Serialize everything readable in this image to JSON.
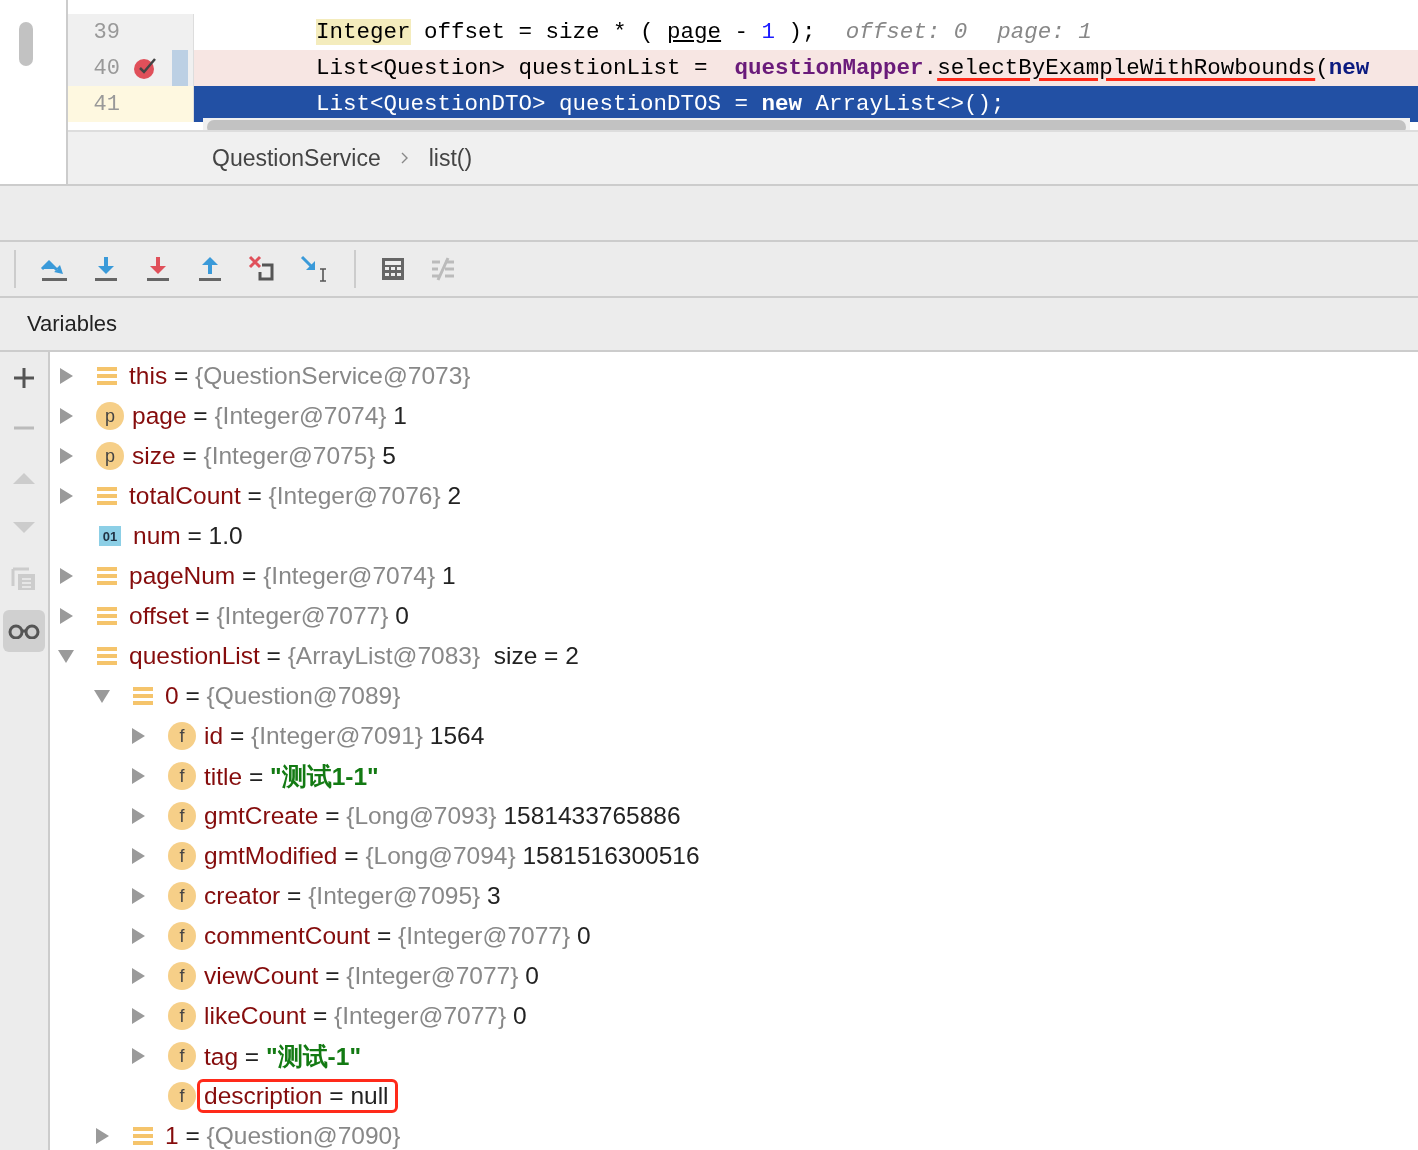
{
  "editor": {
    "lines": [
      {
        "number": "39",
        "current": false,
        "breakpoint": false,
        "tokens": [
          {
            "kind": "highlight",
            "text": "Integer"
          },
          {
            "kind": "plain",
            "text": " offset = size * ( "
          },
          {
            "kind": "underline",
            "text": "page"
          },
          {
            "kind": "plain",
            "text": " - "
          },
          {
            "kind": "number",
            "text": "1"
          },
          {
            "kind": "plain",
            "text": " );"
          },
          {
            "kind": "hint",
            "text": "offset: 0"
          },
          {
            "kind": "hint",
            "text": "page: 1"
          }
        ]
      },
      {
        "number": "40",
        "current": false,
        "breakpoint": true,
        "tokens": [
          {
            "kind": "plain",
            "text": "List<Question> questionList =  "
          },
          {
            "kind": "field",
            "text": "questionMapper"
          },
          {
            "kind": "plain",
            "text": "."
          },
          {
            "kind": "marked",
            "text": "selectByExampleWithRowbounds"
          },
          {
            "kind": "plain",
            "text": "("
          },
          {
            "kind": "keyword",
            "text": "new"
          }
        ]
      },
      {
        "number": "41",
        "current": true,
        "breakpoint": false,
        "tokens": [
          {
            "kind": "plain",
            "text": "List<QuestionDTO> questionDTOS = "
          },
          {
            "kind": "keyword",
            "text": "new"
          },
          {
            "kind": "plain",
            "text": " ArrayList<>();"
          }
        ]
      }
    ],
    "breadcrumbs": [
      "QuestionService",
      "list()"
    ]
  },
  "panel": {
    "title": "Variables"
  },
  "variables": [
    {
      "kind": "object",
      "name": "this",
      "op": "=",
      "ref": "{QuestionService@7073}",
      "expanded": false,
      "marked": false
    },
    {
      "kind": "param",
      "badge": "p",
      "name": "page",
      "op": "=",
      "ref": "{Integer@7074}",
      "value": "1",
      "expanded": false,
      "marked": false
    },
    {
      "kind": "param",
      "badge": "p",
      "name": "size",
      "op": "=",
      "ref": "{Integer@7075}",
      "value": "5",
      "expanded": false,
      "marked": false
    },
    {
      "kind": "object",
      "name": "totalCount",
      "op": "=",
      "ref": "{Integer@7076}",
      "value": "2",
      "expanded": false,
      "marked": false
    },
    {
      "kind": "primitive",
      "badge": "01",
      "name": "num",
      "op": "=",
      "value": "1.0",
      "marked": false
    },
    {
      "kind": "object",
      "name": "pageNum",
      "op": "=",
      "ref": "{Integer@7074}",
      "value": "1",
      "expanded": false,
      "marked": false
    },
    {
      "kind": "object",
      "name": "offset",
      "op": "=",
      "ref": "{Integer@7077}",
      "value": "0",
      "expanded": false,
      "marked": false
    },
    {
      "kind": "object",
      "name": "questionList",
      "op": "=",
      "ref": "{ArrayList@7083}",
      "value": " size = 2",
      "expanded": true,
      "marked": false,
      "children": [
        {
          "kind": "object",
          "name": "0",
          "op": "=",
          "ref": "{Question@7089}",
          "expanded": true,
          "marked": false,
          "children": [
            {
              "kind": "field",
              "badge": "f",
              "name": "id",
              "op": "=",
              "ref": "{Integer@7091}",
              "value": "1564",
              "expanded": false,
              "marked": false
            },
            {
              "kind": "field",
              "badge": "f",
              "name": "title",
              "op": "=",
              "value": "\"测试1-1\"",
              "string": true,
              "expanded": false,
              "marked": false
            },
            {
              "kind": "field",
              "badge": "f",
              "name": "gmtCreate",
              "op": "=",
              "ref": "{Long@7093}",
              "value": "1581433765886",
              "expanded": false,
              "marked": false
            },
            {
              "kind": "field",
              "badge": "f",
              "name": "gmtModified",
              "op": "=",
              "ref": "{Long@7094}",
              "value": "1581516300516",
              "expanded": false,
              "marked": false
            },
            {
              "kind": "field",
              "badge": "f",
              "name": "creator",
              "op": "=",
              "ref": "{Integer@7095}",
              "value": "3",
              "expanded": false,
              "marked": false
            },
            {
              "kind": "field",
              "badge": "f",
              "name": "commentCount",
              "op": "=",
              "ref": "{Integer@7077}",
              "value": "0",
              "expanded": false,
              "marked": false
            },
            {
              "kind": "field",
              "badge": "f",
              "name": "viewCount",
              "op": "=",
              "ref": "{Integer@7077}",
              "value": "0",
              "expanded": false,
              "marked": false
            },
            {
              "kind": "field",
              "badge": "f",
              "name": "likeCount",
              "op": "=",
              "ref": "{Integer@7077}",
              "value": "0",
              "expanded": false,
              "marked": false
            },
            {
              "kind": "field",
              "badge": "f",
              "name": "tag",
              "op": "=",
              "value": "\"测试-1\"",
              "string": true,
              "expanded": false,
              "marked": false
            },
            {
              "kind": "field",
              "badge": "f",
              "name": "description",
              "op": "=",
              "value": "null",
              "marked": true
            }
          ]
        },
        {
          "kind": "object",
          "name": "1",
          "op": "=",
          "ref": "{Question@7090}",
          "expanded": false,
          "marked": false
        }
      ]
    }
  ]
}
